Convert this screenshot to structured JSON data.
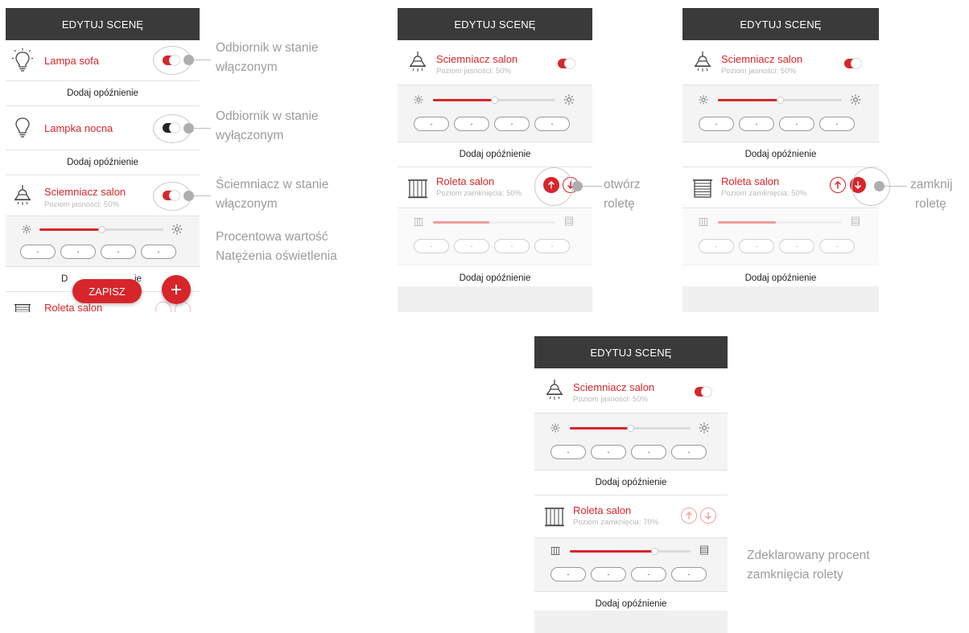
{
  "header_title": "EDYTUJ SCENĘ",
  "delay_label": "Dodaj opóźnienie",
  "preset_value": "-",
  "accent_color": "#d7262b",
  "screen1": {
    "devices": [
      {
        "name": "Lampa sofa",
        "icon": "bulb-on-icon",
        "toggle": "on"
      },
      {
        "name": "Lampka nocna",
        "icon": "bulb-off-icon",
        "toggle": "off"
      },
      {
        "name": "Sciemniacz salon",
        "subtitle": "Poziom jasności: 50%",
        "icon": "dimmer-lamp-icon",
        "toggle": "on",
        "brightness": 0.5
      },
      {
        "name": "Roleta salon",
        "icon": "blind-icon"
      }
    ],
    "save_label": "ZAPISZ",
    "partial_delay_left": "D",
    "partial_delay_right": "ie",
    "fab_icon": "plus-icon"
  },
  "screen2": {
    "dimmer": {
      "name": "Sciemniacz salon",
      "subtitle": "Poziom jasności: 50%",
      "brightness": 0.5
    },
    "blind": {
      "name": "Roleta salon",
      "subtitle": "Poziom zamknięcia: 50%",
      "active_button": "up"
    }
  },
  "screen3": {
    "dimmer": {
      "name": "Sciemniacz salon",
      "subtitle": "Poziom jasności: 50%",
      "brightness": 0.5
    },
    "blind": {
      "name": "Roleta salon",
      "subtitle": "Poziom zamknięcia: 50%",
      "active_button": "down"
    }
  },
  "screen4": {
    "dimmer": {
      "name": "Sciemniacz salon",
      "subtitle": "Poziom jasności: 50%",
      "brightness": 0.5
    },
    "blind": {
      "name": "Roleta salon",
      "subtitle": "Poziom zamknięcia: 70%",
      "closure": 0.7
    }
  },
  "annotations": {
    "receiver_on_1": "Odbiornik w stanie",
    "receiver_on_2": "włączonym",
    "receiver_off_1": "Odbiornik w stanie",
    "receiver_off_2": "wyłączonym",
    "dimmer_on_1": "Ściemniacz w stanie",
    "dimmer_on_2": "włączonym",
    "percent_1": "Procentowa wartość",
    "percent_2": "Natężenia oświetlenia",
    "open_1": "otwórz",
    "open_2": "roletę",
    "close_1": "zamknij",
    "close_2": "roletę",
    "declared_1": "Zdeklarowany procent",
    "declared_2": "zamknięcia rolety"
  }
}
